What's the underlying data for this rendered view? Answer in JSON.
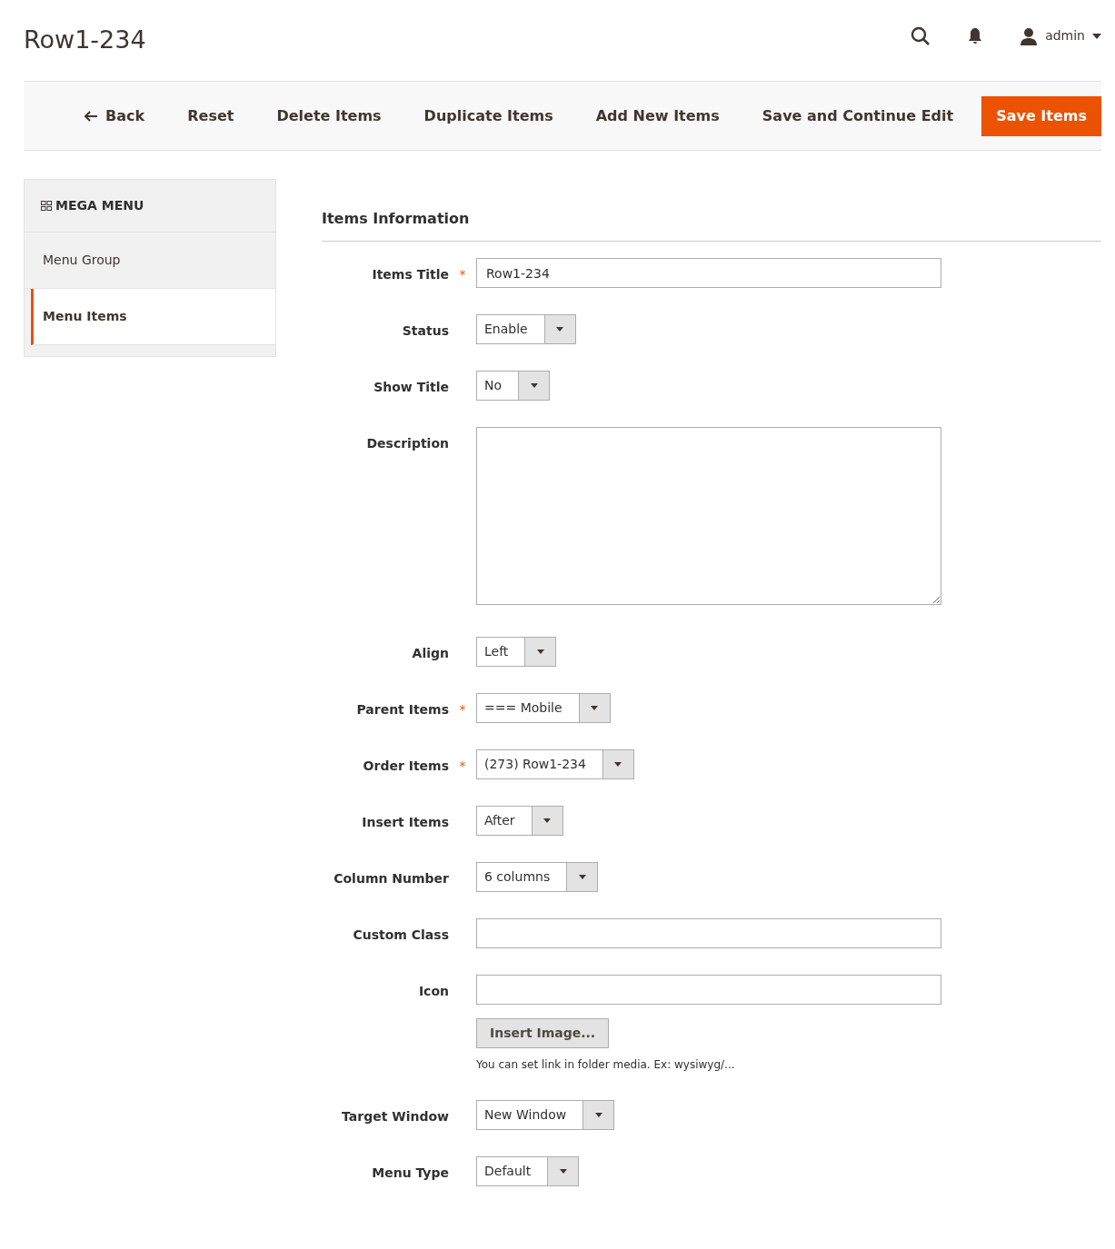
{
  "page_title": "Row1-234",
  "header": {
    "user": "admin"
  },
  "toolbar": {
    "back": "Back",
    "actions": [
      "Reset",
      "Delete Items",
      "Duplicate Items",
      "Add New Items",
      "Save and Continue Edit"
    ],
    "primary": "Save Items"
  },
  "sidebar": {
    "title": "MEGA MENU",
    "items": [
      {
        "label": "Menu Group",
        "selected": false
      },
      {
        "label": "Menu Items",
        "selected": true
      }
    ]
  },
  "section_title": "Items Information",
  "fields": [
    {
      "label": "Items Title",
      "required_mark": "*",
      "kind": "text",
      "value": "Row1-234"
    },
    {
      "label": "Status",
      "kind": "select",
      "value": "Enable"
    },
    {
      "label": "Show Title",
      "kind": "select",
      "value": "No"
    },
    {
      "label": "Description",
      "kind": "textarea"
    },
    {
      "label": "Align",
      "kind": "select",
      "value": "Left"
    },
    {
      "label": "Parent Items",
      "required_mark": "*",
      "kind": "select",
      "value": "=== Mobile"
    },
    {
      "label": "Order Items",
      "required_mark": "*",
      "kind": "select",
      "value": "(273) Row1-234"
    },
    {
      "label": "Insert Items",
      "kind": "select",
      "value": "After"
    },
    {
      "label": "Column Number",
      "kind": "select",
      "value": "6 columns"
    },
    {
      "label": "Custom Class",
      "kind": "text"
    },
    {
      "label": "Icon",
      "kind": "text",
      "button": "Insert Image...",
      "note": "You can set link in folder media. Ex: wysiwyg/..."
    },
    {
      "label": "Target Window",
      "kind": "select",
      "value": "New Window"
    },
    {
      "label": "Menu Type",
      "kind": "select",
      "value": "Default"
    }
  ]
}
